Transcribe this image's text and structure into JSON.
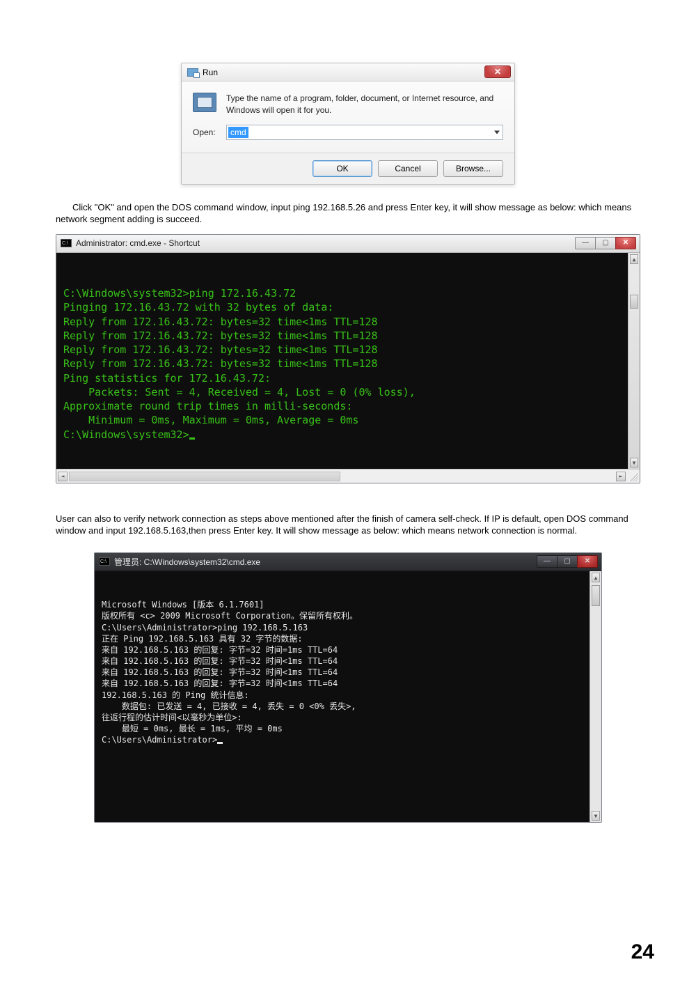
{
  "run_dialog": {
    "title": "Run",
    "close_glyph": "✕",
    "message": "Type the name of a program, folder, document, or Internet resource, and Windows will open it for you.",
    "open_label": "Open:",
    "input_value": "cmd",
    "buttons": {
      "ok": "OK",
      "cancel": "Cancel",
      "browse": "Browse..."
    }
  },
  "paragraph1": "Click \"OK\" and open the DOS command window, input ping 192.168.5.26 and press Enter key, it will show message as below: which means network segment adding is succeed.",
  "cmd1": {
    "title": "Administrator: cmd.exe - Shortcut",
    "lines": [
      "C:\\Windows\\system32>ping 172.16.43.72",
      "",
      "Pinging 172.16.43.72 with 32 bytes of data:",
      "Reply from 172.16.43.72: bytes=32 time<1ms TTL=128",
      "Reply from 172.16.43.72: bytes=32 time<1ms TTL=128",
      "Reply from 172.16.43.72: bytes=32 time<1ms TTL=128",
      "Reply from 172.16.43.72: bytes=32 time<1ms TTL=128",
      "",
      "Ping statistics for 172.16.43.72:",
      "    Packets: Sent = 4, Received = 4, Lost = 0 (0% loss),",
      "Approximate round trip times in milli-seconds:",
      "    Minimum = 0ms, Maximum = 0ms, Average = 0ms",
      "",
      "C:\\Windows\\system32>"
    ]
  },
  "paragraph2": "User can also to verify network connection as steps above mentioned after the finish of camera self-check. If IP is default, open DOS command window and input 192.168.5.163,then press Enter key. It will show message as below: which means network connection is normal.",
  "cmd2": {
    "title": "管理员: C:\\Windows\\system32\\cmd.exe",
    "lines": [
      "Microsoft Windows [版本 6.1.7601]",
      "版权所有 <c> 2009 Microsoft Corporation。保留所有权利。",
      "",
      "C:\\Users\\Administrator>ping 192.168.5.163",
      "",
      "正在 Ping 192.168.5.163 具有 32 字节的数据:",
      "来自 192.168.5.163 的回复: 字节=32 时间=1ms TTL=64",
      "来自 192.168.5.163 的回复: 字节=32 时间<1ms TTL=64",
      "来自 192.168.5.163 的回复: 字节=32 时间<1ms TTL=64",
      "来自 192.168.5.163 的回复: 字节=32 时间<1ms TTL=64",
      "",
      "192.168.5.163 的 Ping 统计信息:",
      "    数据包: 已发送 = 4, 已接收 = 4, 丢失 = 0 <0% 丢失>,",
      "往返行程的估计时间<以毫秒为单位>:",
      "    最短 = 0ms, 最长 = 1ms, 平均 = 0ms",
      "",
      "C:\\Users\\Administrator>"
    ]
  },
  "controls": {
    "min": "—",
    "max": "▢",
    "close": "✕",
    "sysicon": "C:\\"
  },
  "page_number": "24"
}
